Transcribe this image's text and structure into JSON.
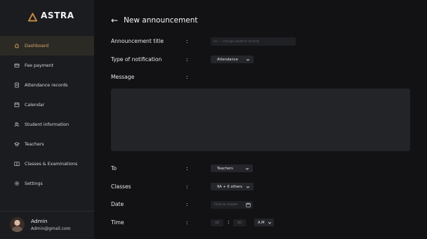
{
  "app": {
    "name": "ASTRA",
    "accent": "#d7a66a"
  },
  "sidebar": {
    "items": [
      {
        "label": "Dashboard",
        "icon": "home-icon",
        "active": true
      },
      {
        "label": "Fee payment",
        "icon": "wallet-icon",
        "active": false
      },
      {
        "label": "Attendance records",
        "icon": "clipboard-icon",
        "active": false
      },
      {
        "label": "Calendar",
        "icon": "calendar-icon",
        "active": false
      },
      {
        "label": "Student information",
        "icon": "users-icon",
        "active": false
      },
      {
        "label": "Teachers",
        "icon": "graduation-cap-icon",
        "active": false
      },
      {
        "label": "Classes & Examinations",
        "icon": "book-icon",
        "active": false
      },
      {
        "label": "Settings",
        "icon": "gear-icon",
        "active": false
      }
    ],
    "profile": {
      "name": "Admin",
      "email": "Admin@gmail.com"
    }
  },
  "header": {
    "back_icon": "arrow-left-icon",
    "title": "New announcement"
  },
  "form": {
    "colon": ":",
    "title_label": "Announcement title",
    "title_placeholder": "ex : - Change student records",
    "type_label": "Type of notification",
    "type_value": "Attendance",
    "message_label": "Message",
    "to_label": "To",
    "to_value": "Teachers",
    "classes_label": "Classes",
    "classes_value": "9A + 6 others",
    "date_label": "Date",
    "date_placeholder": "Click to choose",
    "time_label": "Time",
    "hour_placeholder": "00",
    "minute_placeholder": "00",
    "ampm_value": "A.M"
  }
}
